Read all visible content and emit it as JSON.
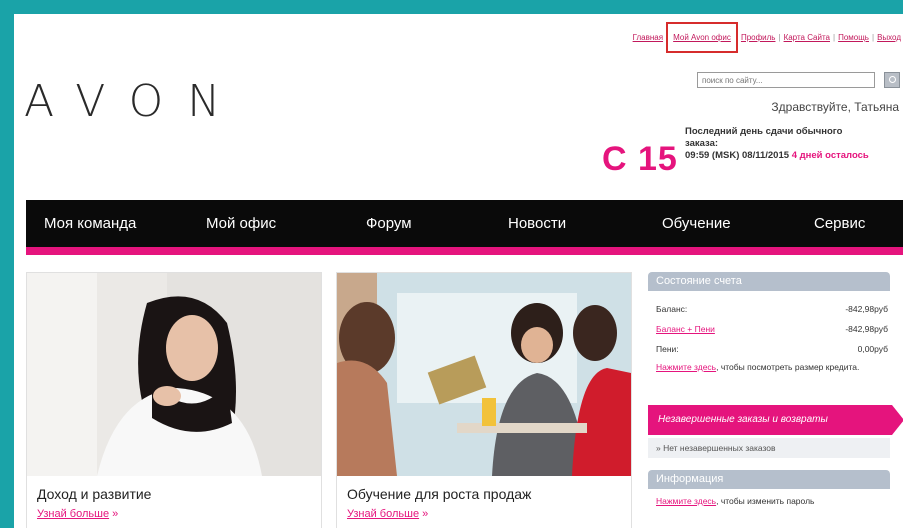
{
  "header": {
    "links": [
      {
        "label": "Главная",
        "highlighted": false
      },
      {
        "label": "Мой Avon офис",
        "highlighted": true
      },
      {
        "label": "Профиль",
        "highlighted": false
      },
      {
        "label": "Карта Сайта",
        "highlighted": false
      },
      {
        "label": "Помощь",
        "highlighted": false
      },
      {
        "label": "Выход",
        "highlighted": false
      }
    ],
    "logo_text": "AVON",
    "search_placeholder": "поиск по сайту...",
    "greeting": "Здравствуйте, Татьяна",
    "campaign_code": "C 15",
    "deadline_line1": "Последний день сдачи обычного",
    "deadline_line2": "заказа:",
    "deadline_datetime": "09:59 (MSK) 08/11/2015",
    "deadline_remaining": "4 дней осталось"
  },
  "nav": {
    "items": [
      "Моя команда",
      "Мой офис",
      "Форум",
      "Новости",
      "Обучение",
      "Сервис"
    ]
  },
  "cards": [
    {
      "title": "Доход и развитие",
      "link": "Узнай больше"
    },
    {
      "title": "Обучение для роста продаж",
      "link": "Узнай больше"
    }
  ],
  "account": {
    "header": "Состояние счета",
    "balance_label": "Баланс:",
    "balance_value": "-842,98руб",
    "balance_fees_label": "Баланс + Пени",
    "balance_fees_value": "-842,98руб",
    "fees_label": "Пени:",
    "fees_value": "0,00руб",
    "credit_link": "Нажмите здесь",
    "credit_text": ", чтобы посмотреть размер кредита."
  },
  "orders": {
    "banner": "Незавершенные заказы и возвраты",
    "status": "» Нет незавершенных заказов"
  },
  "info": {
    "header": "Информация",
    "link": "Нажмите здесь",
    "text": ", чтобы изменить пароль"
  },
  "colors": {
    "accent_pink": "#e5147d",
    "nav_black": "#0a0a0a",
    "panel_gray": "#b5bfcc",
    "frame_teal": "#1aa3a8"
  }
}
